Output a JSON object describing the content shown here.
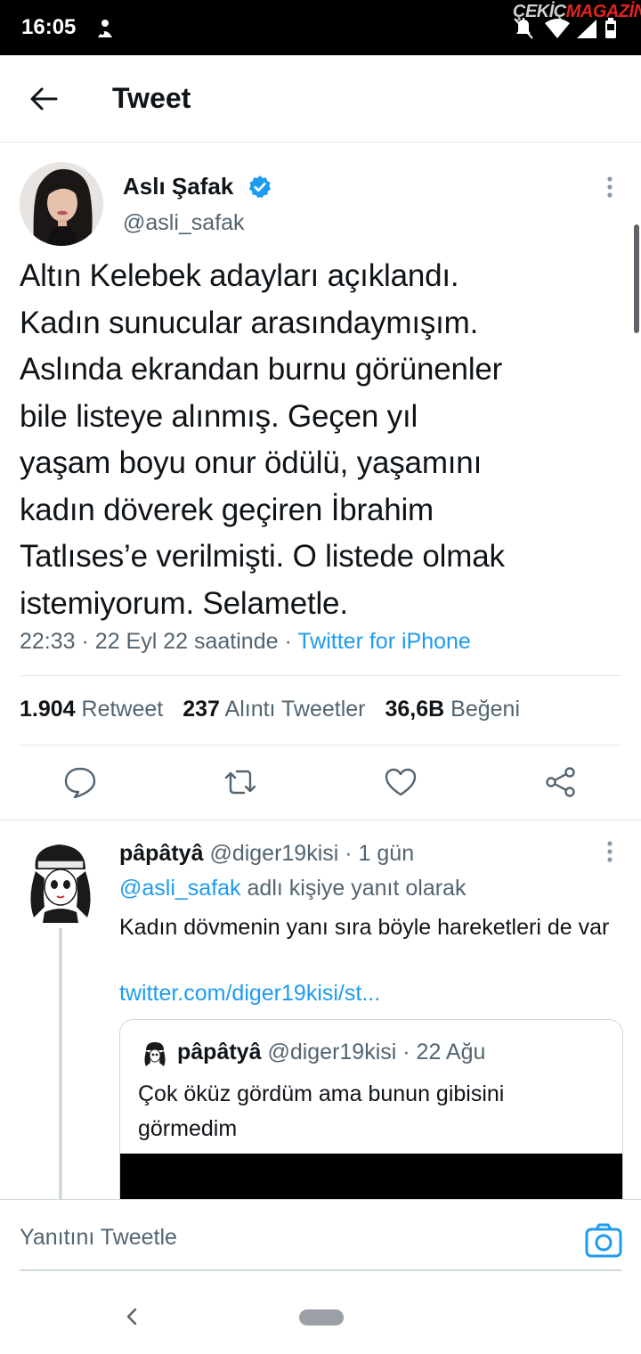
{
  "status_bar": {
    "time": "16:05",
    "watermark_part1": "ÇEKİÇ",
    "watermark_part2": "MAGAZİN"
  },
  "header": {
    "title": "Tweet",
    "back_icon": "arrow-left-icon"
  },
  "tweet": {
    "author_name": "Aslı Şafak",
    "handle": "@asli_safak",
    "verified": true,
    "text_lines": [
      "Altın Kelebek adayları açıklandı.",
      "Kadın sunucular arasındaymışım.",
      "Aslında ekrandan burnu görünenler",
      "bile listeye alınmış. Geçen yıl",
      "yaşam boyu onur ödülü, yaşamını",
      "kadın döverek geçiren İbrahim",
      "Tatlıses’e verilmişti. O listede olmak",
      "istemiyorum. Selametle."
    ],
    "time": "22:33",
    "date": "22 Eyl 22 saatinde",
    "separator": "·",
    "source": "Twitter for iPhone",
    "stats": {
      "retweets_count": "1.904",
      "retweets_label": "Retweet",
      "quotes_count": "237",
      "quotes_label": "Alıntı Tweetler",
      "likes_count": "36,6B",
      "likes_label": "Beğeni"
    },
    "actions": [
      "reply-icon",
      "retweet-icon",
      "like-icon",
      "share-icon"
    ]
  },
  "reply": {
    "name": "pâpâtyâ",
    "handle": "@diger19kisi",
    "time": "· 1 gün",
    "reply_to_handle": "@asli_safak",
    "reply_to_suffix": "adlı kişiye yanıt olarak",
    "text": "Kadın dövmenin yanı sıra böyle hareketleri de var",
    "link": "twitter.com/diger19kisi/st...",
    "quote": {
      "name": "pâpâtyâ",
      "handle": "@diger19kisi",
      "time": "· 22 Ağu",
      "text": "Çok öküz gördüm ama bunun gibisini görmedim"
    }
  },
  "compose": {
    "placeholder": "Yanıtını Tweetle",
    "camera_icon": "camera-icon"
  },
  "colors": {
    "accent": "#1d9bf0",
    "text_primary": "#0f1419",
    "text_secondary": "#536471",
    "divider": "#e7e9ea"
  }
}
